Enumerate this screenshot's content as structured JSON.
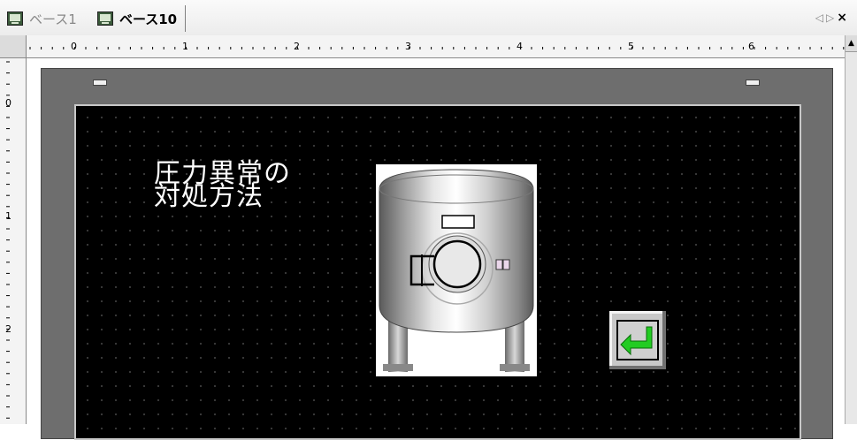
{
  "tabs": [
    {
      "label": "ベース1",
      "active": false,
      "icon": "screen-doc-icon"
    },
    {
      "label": "ベース10",
      "active": true,
      "icon": "screen-doc-icon"
    }
  ],
  "tab_nav": {
    "prev_icon": "◁",
    "next_icon": "▷",
    "close_icon": "×"
  },
  "ruler": {
    "h_labels": [
      "0",
      "1",
      "2",
      "3",
      "4",
      "5",
      "6"
    ],
    "v_labels": [
      "0",
      "1",
      "2"
    ]
  },
  "screen": {
    "title": "圧力異常の\n対処方法",
    "background": "#000000",
    "text_color": "#ffffff"
  },
  "return_button": {
    "icon": "return-arrow-icon",
    "arrow_color": "#22cc22"
  },
  "colors": {
    "frame": "#6e6e6e",
    "accent_green": "#22cc22"
  }
}
